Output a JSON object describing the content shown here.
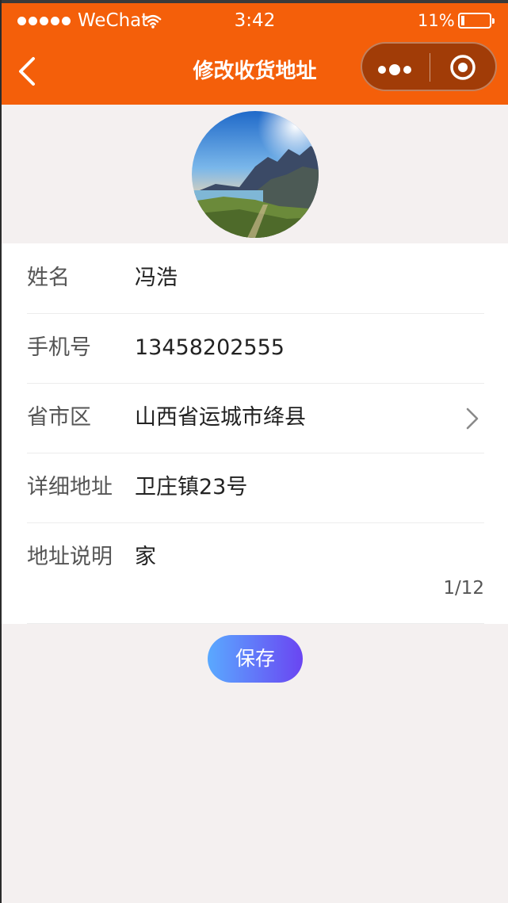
{
  "status_bar": {
    "carrier": "WeChat",
    "time": "3:42",
    "battery_percent": "11%",
    "battery_level": 0.11
  },
  "nav": {
    "title": "修改收货地址",
    "back_icon": "chevron-left-icon",
    "more_icon": "more-dots-icon",
    "close_icon": "target-circle-icon"
  },
  "colors": {
    "nav_bg": "#f45f0a",
    "capsule_bg": "#a13c07",
    "page_bg": "#f4f0f0",
    "button_gradient_start": "#5aa9ff",
    "button_gradient_end": "#6a45f2"
  },
  "form": {
    "fields": [
      {
        "label": "姓名",
        "value": "冯浩"
      },
      {
        "label": "手机号",
        "value": "13458202555"
      },
      {
        "label": "省市区",
        "value": "山西省运城市绛县"
      },
      {
        "label": "详细地址",
        "value": "卫庄镇23号"
      },
      {
        "label": "地址说明",
        "value": "家"
      }
    ],
    "note_counter": "1/12"
  },
  "actions": {
    "save_label": "保存"
  }
}
